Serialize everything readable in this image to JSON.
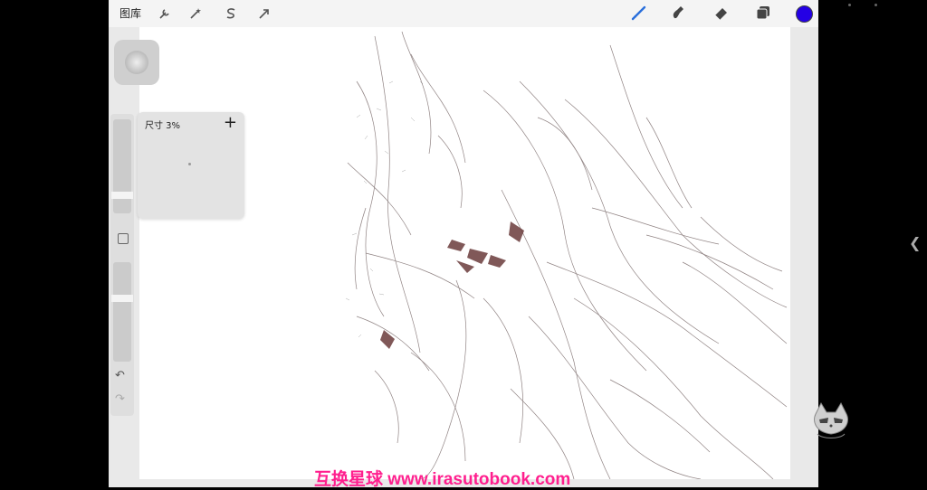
{
  "toolbar": {
    "gallery_label": "图库"
  },
  "brush_popup": {
    "label": "尺寸 3%",
    "plus": "+"
  },
  "sidebar": {
    "undo": "↶",
    "redo": "↷"
  },
  "colors": {
    "accent_swatch": "#2400e5",
    "watermark": "#ff1f8e"
  },
  "watermark": {
    "text": "互换星球 www.irasutobook.com"
  },
  "edge": {
    "chevron": "❮"
  }
}
